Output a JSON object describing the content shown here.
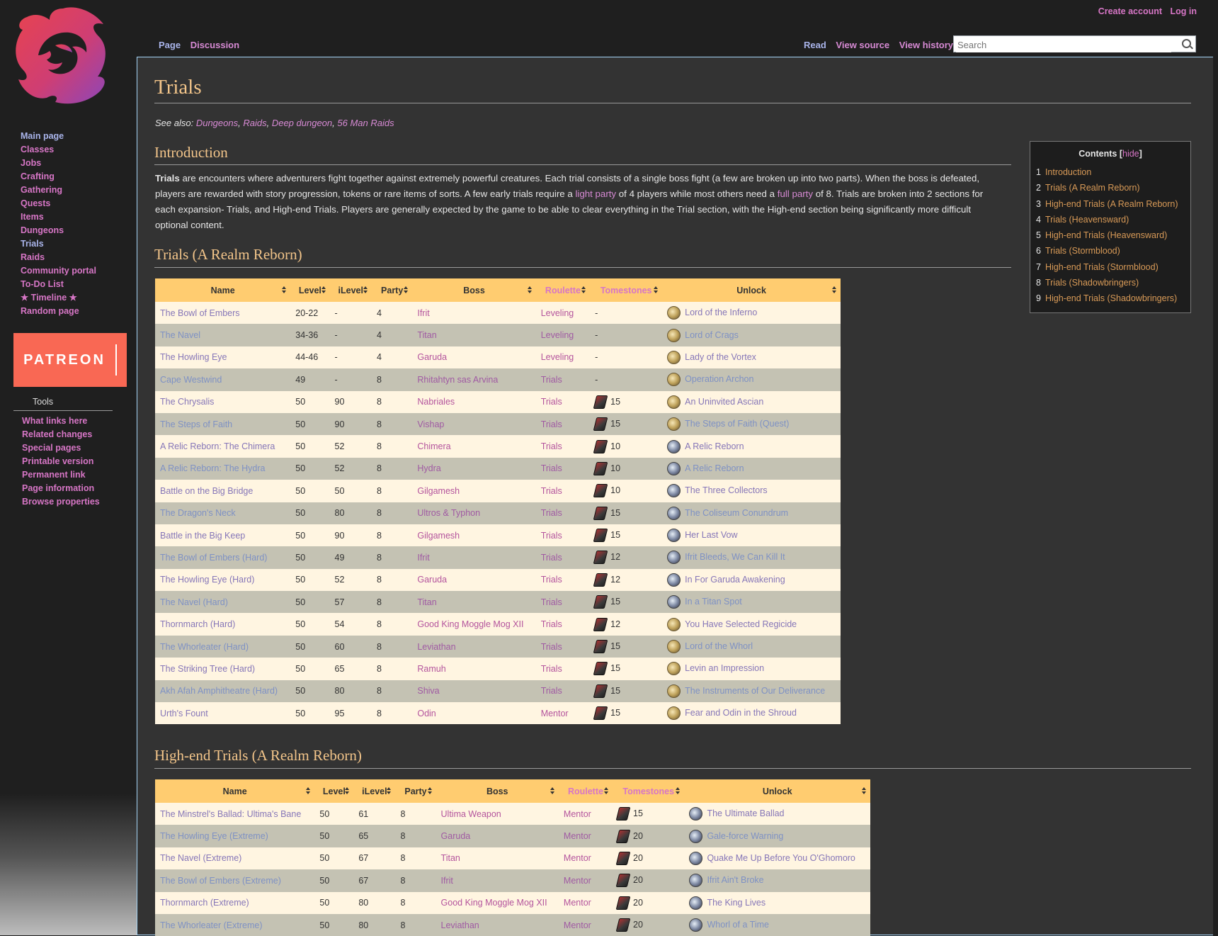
{
  "colors": {
    "accent_link": "#d776c6",
    "heading": "#f3c58a",
    "table_header": "#ffcc70",
    "row_odd": "#fff5e1",
    "row_even": "#c4c2b3",
    "patreon": "#f96854"
  },
  "personal": {
    "create_account": "Create account",
    "log_in": "Log in"
  },
  "tabs": {
    "page": "Page",
    "discussion": "Discussion",
    "read": "Read",
    "view_source": "View source",
    "view_history": "View history"
  },
  "search": {
    "placeholder": "Search"
  },
  "sidebar": {
    "nav": [
      "Main page",
      "Classes",
      "Jobs",
      "Crafting",
      "Gathering",
      "Quests",
      "Items",
      "Dungeons",
      "Trials",
      "Raids",
      "Community portal",
      "To-Do List",
      "★ Timeline ★",
      "Random page"
    ],
    "patreon": "PATREON",
    "tools_heading": "Tools",
    "tools": [
      "What links here",
      "Related changes",
      "Special pages",
      "Printable version",
      "Permanent link",
      "Page information",
      "Browse properties"
    ]
  },
  "page": {
    "title": "Trials",
    "see_also_label": "See also:",
    "see_also": [
      "Dungeons",
      "Raids",
      "Deep dungeon",
      "56 Man Raids"
    ],
    "intro_heading": "Introduction",
    "intro_bold": "Trials",
    "intro_p1": " are encounters where adventurers fight together against extremely powerful creatures. Each trial consists of a single boss fight (a few are broken up into two parts). When the boss is defeated, players are rewarded with story progression, tokens or rare items of sorts. A few early trials require a ",
    "intro_link1": "light party",
    "intro_p2": " of 4 players while most others need a ",
    "intro_link2": "full party",
    "intro_p3": " of 8. Trials are broken into 2 sections for each expansion- Trials, and High-end Trials. Players are generally expected by the game to be able to clear everything in the Trial section, with the High-end section being significantly more difficult optional content.",
    "section1": "Trials (A Realm Reborn)",
    "section2": "High-end Trials (A Realm Reborn)"
  },
  "toc": {
    "title": "Contents",
    "hide": "hide",
    "items": [
      {
        "n": "1",
        "t": "Introduction"
      },
      {
        "n": "2",
        "t": "Trials (A Realm Reborn)"
      },
      {
        "n": "3",
        "t": "High-end Trials (A Realm Reborn)"
      },
      {
        "n": "4",
        "t": "Trials (Heavensward)"
      },
      {
        "n": "5",
        "t": "High-end Trials (Heavensward)"
      },
      {
        "n": "6",
        "t": "Trials (Stormblood)"
      },
      {
        "n": "7",
        "t": "High-end Trials (Stormblood)"
      },
      {
        "n": "8",
        "t": "Trials (Shadowbringers)"
      },
      {
        "n": "9",
        "t": "High-end Trials (Shadowbringers)"
      }
    ]
  },
  "columns": [
    "Name",
    "Level",
    "iLevel",
    "Party",
    "Boss",
    "Roulette",
    "Tomestones",
    "Unlock"
  ],
  "trials_arr": [
    {
      "name": "The Bowl of Embers",
      "level": "20-22",
      "ilevel": "-",
      "party": "4",
      "boss": "Ifrit",
      "roulette": "Leveling",
      "tomes": "-",
      "unlock": "Lord of the Inferno",
      "icon": "gold"
    },
    {
      "name": "The Navel",
      "level": "34-36",
      "ilevel": "-",
      "party": "4",
      "boss": "Titan",
      "roulette": "Leveling",
      "tomes": "-",
      "unlock": "Lord of Crags",
      "icon": "gold"
    },
    {
      "name": "The Howling Eye",
      "level": "44-46",
      "ilevel": "-",
      "party": "4",
      "boss": "Garuda",
      "roulette": "Leveling",
      "tomes": "-",
      "unlock": "Lady of the Vortex",
      "icon": "gold"
    },
    {
      "name": "Cape Westwind",
      "level": "49",
      "ilevel": "-",
      "party": "8",
      "boss": "Rhitahtyn sas Arvina",
      "roulette": "Trials",
      "tomes": "-",
      "unlock": "Operation Archon",
      "icon": "gold"
    },
    {
      "name": "The Chrysalis",
      "level": "50",
      "ilevel": "90",
      "party": "8",
      "boss": "Nabriales",
      "roulette": "Trials",
      "tomes": "15",
      "unlock": "An Uninvited Ascian",
      "icon": "gold"
    },
    {
      "name": "The Steps of Faith",
      "level": "50",
      "ilevel": "90",
      "party": "8",
      "boss": "Vishap",
      "roulette": "Trials",
      "tomes": "15",
      "unlock": "The Steps of Faith (Quest)",
      "icon": "gold"
    },
    {
      "name": "A Relic Reborn: The Chimera",
      "level": "50",
      "ilevel": "52",
      "party": "8",
      "boss": "Chimera",
      "roulette": "Trials",
      "tomes": "10",
      "unlock": "A Relic Reborn",
      "icon": "blue"
    },
    {
      "name": "A Relic Reborn: The Hydra",
      "level": "50",
      "ilevel": "52",
      "party": "8",
      "boss": "Hydra",
      "roulette": "Trials",
      "tomes": "10",
      "unlock": "A Relic Reborn",
      "icon": "blue"
    },
    {
      "name": "Battle on the Big Bridge",
      "level": "50",
      "ilevel": "50",
      "party": "8",
      "boss": "Gilgamesh",
      "roulette": "Trials",
      "tomes": "10",
      "unlock": "The Three Collectors",
      "icon": "blue"
    },
    {
      "name": "The Dragon's Neck",
      "level": "50",
      "ilevel": "80",
      "party": "8",
      "boss": "Ultros & Typhon",
      "roulette": "Trials",
      "tomes": "15",
      "unlock": "The Coliseum Conundrum",
      "icon": "blue"
    },
    {
      "name": "Battle in the Big Keep",
      "level": "50",
      "ilevel": "90",
      "party": "8",
      "boss": "Gilgamesh",
      "roulette": "Trials",
      "tomes": "15",
      "unlock": "Her Last Vow",
      "icon": "blue"
    },
    {
      "name": "The Bowl of Embers (Hard)",
      "level": "50",
      "ilevel": "49",
      "party": "8",
      "boss": "Ifrit",
      "roulette": "Trials",
      "tomes": "12",
      "unlock": "Ifrit Bleeds, We Can Kill It",
      "icon": "blue"
    },
    {
      "name": "The Howling Eye (Hard)",
      "level": "50",
      "ilevel": "52",
      "party": "8",
      "boss": "Garuda",
      "roulette": "Trials",
      "tomes": "12",
      "unlock": "In For Garuda Awakening",
      "icon": "blue"
    },
    {
      "name": "The Navel (Hard)",
      "level": "50",
      "ilevel": "57",
      "party": "8",
      "boss": "Titan",
      "roulette": "Trials",
      "tomes": "15",
      "unlock": "In a Titan Spot",
      "icon": "blue"
    },
    {
      "name": "Thornmarch (Hard)",
      "level": "50",
      "ilevel": "54",
      "party": "8",
      "boss": "Good King Moggle Mog XII",
      "roulette": "Trials",
      "tomes": "12",
      "unlock": "You Have Selected Regicide",
      "icon": "gold"
    },
    {
      "name": "The Whorleater (Hard)",
      "level": "50",
      "ilevel": "60",
      "party": "8",
      "boss": "Leviathan",
      "roulette": "Trials",
      "tomes": "15",
      "unlock": "Lord of the Whorl",
      "icon": "gold"
    },
    {
      "name": "The Striking Tree (Hard)",
      "level": "50",
      "ilevel": "65",
      "party": "8",
      "boss": "Ramuh",
      "roulette": "Trials",
      "tomes": "15",
      "unlock": "Levin an Impression",
      "icon": "gold"
    },
    {
      "name": "Akh Afah Amphitheatre (Hard)",
      "level": "50",
      "ilevel": "80",
      "party": "8",
      "boss": "Shiva",
      "roulette": "Trials",
      "tomes": "15",
      "unlock": "The Instruments of Our Deliverance",
      "icon": "gold"
    },
    {
      "name": "Urth's Fount",
      "level": "50",
      "ilevel": "95",
      "party": "8",
      "boss": "Odin",
      "roulette": "Mentor",
      "tomes": "15",
      "unlock": "Fear and Odin in the Shroud",
      "icon": "gold"
    }
  ],
  "highend_arr": [
    {
      "name": "The Minstrel's Ballad: Ultima's Bane",
      "level": "50",
      "ilevel": "61",
      "party": "8",
      "boss": "Ultima Weapon",
      "roulette": "Mentor",
      "tomes": "15",
      "unlock": "The Ultimate Ballad",
      "icon": "blue"
    },
    {
      "name": "The Howling Eye (Extreme)",
      "level": "50",
      "ilevel": "65",
      "party": "8",
      "boss": "Garuda",
      "roulette": "Mentor",
      "tomes": "20",
      "unlock": "Gale-force Warning",
      "icon": "blue"
    },
    {
      "name": "The Navel (Extreme)",
      "level": "50",
      "ilevel": "67",
      "party": "8",
      "boss": "Titan",
      "roulette": "Mentor",
      "tomes": "20",
      "unlock": "Quake Me Up Before You O'Ghomoro",
      "icon": "blue"
    },
    {
      "name": "The Bowl of Embers (Extreme)",
      "level": "50",
      "ilevel": "67",
      "party": "8",
      "boss": "Ifrit",
      "roulette": "Mentor",
      "tomes": "20",
      "unlock": "Ifrit Ain't Broke",
      "icon": "blue"
    },
    {
      "name": "Thornmarch (Extreme)",
      "level": "50",
      "ilevel": "80",
      "party": "8",
      "boss": "Good King Moggle Mog XII",
      "roulette": "Mentor",
      "tomes": "20",
      "unlock": "The King Lives",
      "icon": "blue"
    },
    {
      "name": "The Whorleater (Extreme)",
      "level": "50",
      "ilevel": "80",
      "party": "8",
      "boss": "Leviathan",
      "roulette": "Mentor",
      "tomes": "20",
      "unlock": "Whorl of a Time",
      "icon": "blue"
    }
  ]
}
